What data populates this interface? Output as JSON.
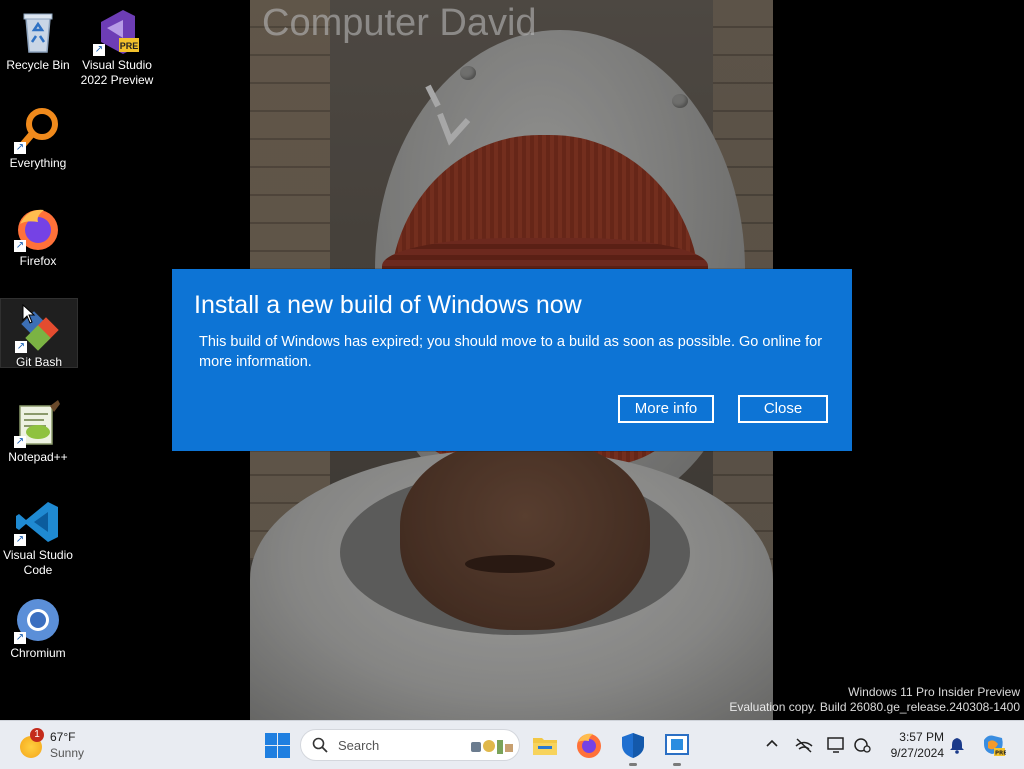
{
  "wallpaper": {
    "caption": "Computer David"
  },
  "desktop_icons": [
    {
      "label": "Recycle Bin",
      "icon": "recycle-bin-icon"
    },
    {
      "label": "Visual Studio 2022 Preview",
      "icon": "visual-studio-preview-icon",
      "badge": "PRE"
    },
    {
      "label": "Everything",
      "icon": "everything-search-icon"
    },
    {
      "label": "Firefox",
      "icon": "firefox-icon"
    },
    {
      "label": "Git Bash",
      "icon": "git-bash-icon"
    },
    {
      "label": "Notepad++",
      "icon": "notepad-plus-plus-icon"
    },
    {
      "label": "Visual Studio Code",
      "icon": "vscode-icon"
    },
    {
      "label": "Chromium",
      "icon": "chromium-icon"
    }
  ],
  "dialog": {
    "title": "Install a new build of Windows now",
    "message": "This build of Windows has expired; you should move to a build as soon as possible. Go online for more information.",
    "buttons": {
      "more_info": "More info",
      "close": "Close"
    },
    "background_color": "#0d74d5"
  },
  "watermark": {
    "line1": "Windows 11 Pro Insider Preview",
    "line2": "Evaluation copy. Build 26080.ge_release.240308-1400"
  },
  "taskbar": {
    "weather": {
      "temperature": "67°F",
      "condition": "Sunny",
      "badge_count": "1"
    },
    "search_placeholder": "Search",
    "pinned_apps": [
      "file-explorer-icon",
      "firefox-icon",
      "windows-security-icon",
      "app-window-icon"
    ],
    "tray": [
      "chevron-up-icon",
      "network-off-icon",
      "display-icon",
      "accessibility-icon"
    ],
    "clock": {
      "time": "3:57 PM",
      "date": "9/27/2024"
    }
  },
  "colors": {
    "accent": "#0d74d5",
    "taskbar": "#e9ecf2",
    "desktop": "#000000"
  }
}
